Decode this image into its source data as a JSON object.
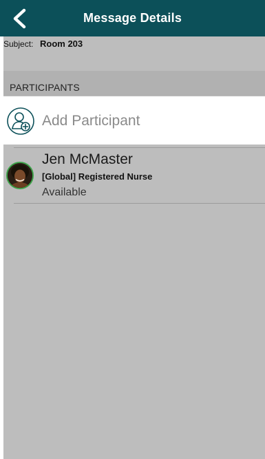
{
  "nav": {
    "title": "Message Details",
    "back_icon": "chevron-left-icon",
    "background_color": "#0c5059"
  },
  "subject": {
    "label": "Subject:",
    "value": "Room 203"
  },
  "participants_section": {
    "header": "PARTICIPANTS",
    "add_participant": {
      "label": "Add Participant",
      "icon": "add-user-icon",
      "icon_color": "#0c5059"
    },
    "items": [
      {
        "name": "Jen McMaster",
        "role": "[Global] Registered Nurse",
        "status": "Available",
        "status_ring_color": "#3ea24a",
        "avatar": "avatar-photo"
      }
    ]
  }
}
